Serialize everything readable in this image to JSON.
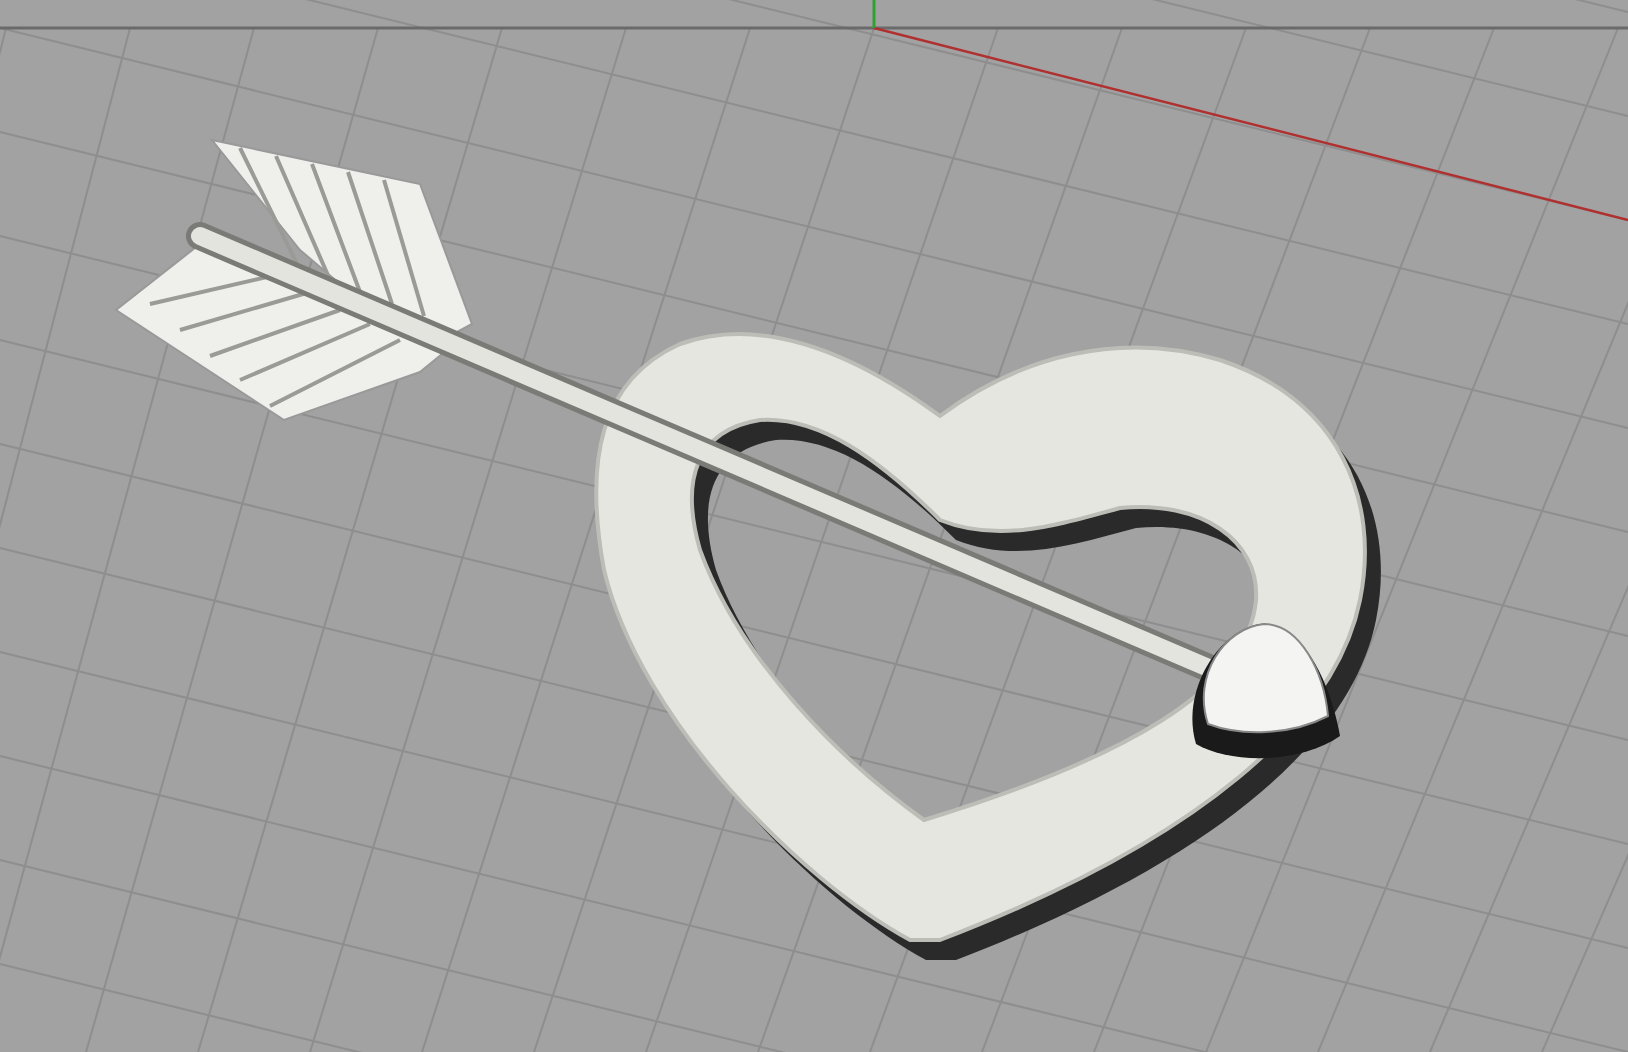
{
  "viewport": {
    "objects": [
      {
        "kind": "heart"
      },
      {
        "kind": "arrow"
      }
    ]
  }
}
